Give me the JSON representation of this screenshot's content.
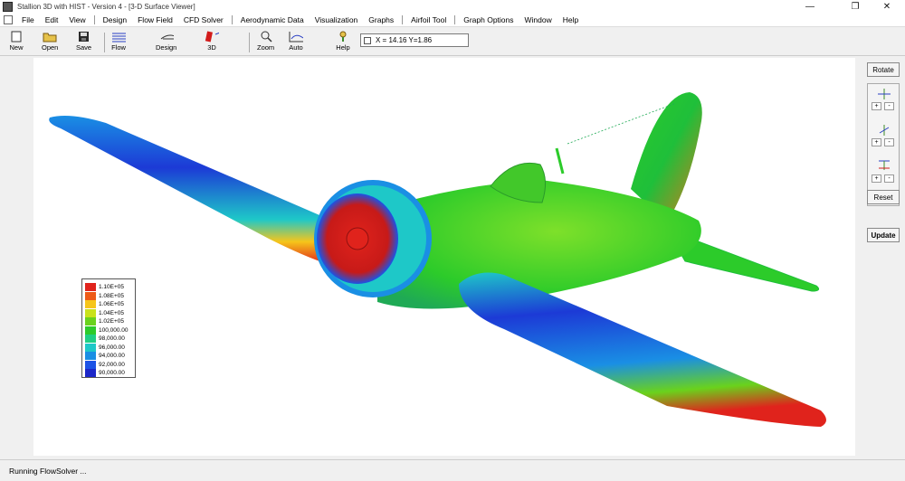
{
  "window": {
    "title": "Stallion 3D with HIST - Version 4 - [3-D Surface Viewer]"
  },
  "menu": [
    "File",
    "Edit",
    "View",
    "Design",
    "Flow Field",
    "CFD Solver",
    "Aerodynamic Data",
    "Visualization",
    "Graphs",
    "Airfoil Tool",
    "Graph Options",
    "Window",
    "Help"
  ],
  "toolbar": {
    "new_label": "New",
    "open_label": "Open",
    "save_label": "Save",
    "flow_label": "Flow",
    "design_label": "Design",
    "threed_label": "3D",
    "zoom_label": "Zoom",
    "auto_label": "Auto",
    "help_label": "Help",
    "coordinates": "X = 14.16  Y=1.86"
  },
  "panel": {
    "rotate_label": "Rotate",
    "axis_x": "X",
    "axis_y": "Y",
    "axis_z": "Z",
    "plus": "+",
    "minus": "-",
    "reset_label": "Reset",
    "update_label": "Update"
  },
  "legend": {
    "entries": [
      {
        "label": "1.10E+05",
        "color": "#e0231c"
      },
      {
        "label": "1.08E+05",
        "color": "#ee5a17"
      },
      {
        "label": "1.06E+05",
        "color": "#f6c51a"
      },
      {
        "label": "1.04E+05",
        "color": "#c9e21a"
      },
      {
        "label": "1.02E+05",
        "color": "#6ad21c"
      },
      {
        "label": "100,000.00",
        "color": "#2ccb2a"
      },
      {
        "label": "98,000.00",
        "color": "#1fcf84"
      },
      {
        "label": "96,000.00",
        "color": "#1ec8c8"
      },
      {
        "label": "94,000.00",
        "color": "#1a8fe4"
      },
      {
        "label": "92,000.00",
        "color": "#1c53e6"
      },
      {
        "label": "90,000.00",
        "color": "#1c27c8"
      }
    ]
  },
  "status": {
    "text": "Running FlowSolver ..."
  }
}
